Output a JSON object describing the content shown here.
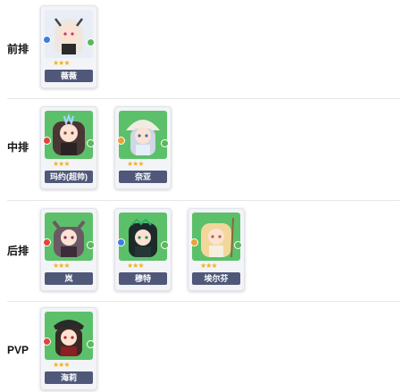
{
  "rows": [
    {
      "label": "前排",
      "cards": [
        {
          "name": "薇薇",
          "element_color": "#3c7de0",
          "bg": "#e9edf5",
          "hair": "#efe7df"
        }
      ]
    },
    {
      "label": "中排",
      "cards": [
        {
          "name": "玛约(超帅)",
          "element_color": "#e0443c",
          "bg": "#5cc06a",
          "hair": "#4a3735"
        },
        {
          "name": "奈亚",
          "element_color": "#e8a23a",
          "bg": "#5cc06a",
          "hair": "#cfd6e6"
        }
      ]
    },
    {
      "label": "后排",
      "cards": [
        {
          "name": "岚",
          "element_color": "#e0443c",
          "bg": "#5cc06a",
          "hair": "#6b5a66"
        },
        {
          "name": "穆特",
          "element_color": "#3c7de0",
          "bg": "#5cc06a",
          "hair": "#1d2a2a"
        },
        {
          "name": "埃尔芬",
          "element_color": "#e8a23a",
          "bg": "#5cc06a",
          "hair": "#f3d79a"
        }
      ]
    },
    {
      "label": "PVP",
      "cards": [
        {
          "name": "海莉",
          "element_color": "#e0443c",
          "bg": "#5cc06a",
          "hair": "#3a2a26"
        }
      ]
    }
  ],
  "star_glyphs": "★★★",
  "icons": {
    "element": "element-icon",
    "class": "class-icon",
    "star": "star-icon"
  }
}
